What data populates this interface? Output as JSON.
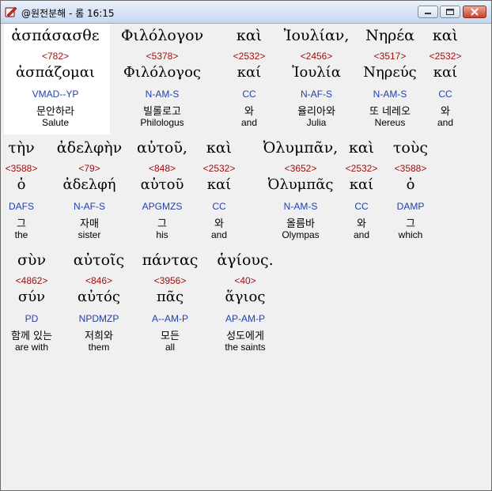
{
  "window": {
    "title": "@원전분해 - 롬 16:15",
    "app_icon": "pen-book-icon"
  },
  "lines": [
    [
      {
        "greek": "ἀσπάσασθε",
        "strong": "<782>",
        "lemma": "ἀσπάζομαι",
        "morph": "VMAD--YP",
        "korean": "문안하라",
        "english": "Salute"
      },
      {
        "greek": "Φιλόλογον",
        "strong": "<5378>",
        "lemma": "Φιλόλογος",
        "morph": "N-AM-S",
        "korean": "빌롤로고",
        "english": "Philologus"
      },
      {
        "greek": "καὶ",
        "strong": "<2532>",
        "lemma": "καί",
        "morph": "CC",
        "korean": "와",
        "english": "and"
      },
      {
        "greek": "Ἰουλίαν,",
        "strong": "<2456>",
        "lemma": "Ἰουλία",
        "morph": "N-AF-S",
        "korean": "율리아와",
        "english": "Julia"
      },
      {
        "greek": "Νηρέα",
        "strong": "<3517>",
        "lemma": "Νηρεύς",
        "morph": "N-AM-S",
        "korean": "또 네레오",
        "english": "Nereus"
      },
      {
        "greek": "καὶ",
        "strong": "<2532>",
        "lemma": "καί",
        "morph": "CC",
        "korean": "와",
        "english": "and"
      }
    ],
    [
      {
        "greek": "τὴν",
        "strong": "<3588>",
        "lemma": "ὁ",
        "morph": "DAFS",
        "korean": "그",
        "english": "the"
      },
      {
        "greek": "ἀδελφὴν",
        "strong": "<79>",
        "lemma": "ἀδελφή",
        "morph": "N-AF-S",
        "korean": "자매",
        "english": "sister"
      },
      {
        "greek": "αὐτοῦ,",
        "strong": "<848>",
        "lemma": "αὑτοῦ",
        "morph": "APGMZS",
        "korean": "그",
        "english": "his"
      },
      {
        "greek": "καὶ",
        "strong": "<2532>",
        "lemma": "καί",
        "morph": "CC",
        "korean": "와",
        "english": "and"
      },
      {
        "greek": "Ὀλυμπᾶν,",
        "strong": "<3652>",
        "lemma": "Ὀλυμπᾶς",
        "morph": "N-AM-S",
        "korean": "올름바",
        "english": "Olympas"
      },
      {
        "greek": "καὶ",
        "strong": "<2532>",
        "lemma": "καί",
        "morph": "CC",
        "korean": "와",
        "english": "and"
      },
      {
        "greek": "τοὺς",
        "strong": "<3588>",
        "lemma": "ὁ",
        "morph": "DAMP",
        "korean": "그",
        "english": "which"
      }
    ],
    [
      {
        "greek": "σὺν",
        "strong": "<4862>",
        "lemma": "σύν",
        "morph": "PD",
        "korean": "함께 있는",
        "english": "are with"
      },
      {
        "greek": "αὐτοῖς",
        "strong": "<846>",
        "lemma": "αὐτός",
        "morph": "NPDMZP",
        "korean": "저희와",
        "english": "them"
      },
      {
        "greek": "πάντας",
        "strong": "<3956>",
        "lemma": "πᾶς",
        "morph": "A--AM-P",
        "korean": "모든",
        "english": "all"
      },
      {
        "greek": "ἁγίους.",
        "strong": "<40>",
        "lemma": "ἅγιος",
        "morph": "AP-AM-P",
        "korean": "성도에게",
        "english": "the saints"
      }
    ]
  ]
}
